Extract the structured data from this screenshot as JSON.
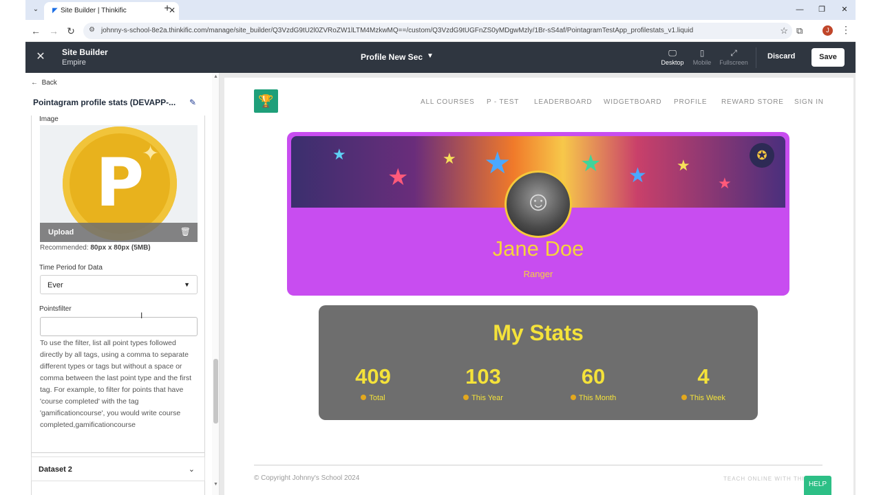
{
  "browser": {
    "tab_title": "Site Builder | Thinkific",
    "tab_favicon": "thinkific-icon",
    "url": "johnny-s-school-8e2a.thinkific.com/manage/site_builder/Q3VzdG9tU2l0ZVRoZW1lLTM4MzkwMQ==/custom/Q3VzdG9tUGFnZS0yMDgwMzly/1Br-sS4af/PointagramTestApp_profilestats_v1.liquid",
    "avatar_initial": "J",
    "avatar_color": "#c0462a"
  },
  "site_builder": {
    "title": "Site Builder",
    "theme": "Empire",
    "page_name": "Profile New Sec",
    "views": [
      "Desktop",
      "Mobile",
      "Fullscreen"
    ],
    "active_view": "Desktop",
    "discard_label": "Discard",
    "save_label": "Save"
  },
  "panel": {
    "back_label": "Back",
    "title": "Pointagram profile stats (DEVAPP-...",
    "image_label": "Image",
    "upload_label": "Upload",
    "recommended_prefix": "Recommended: ",
    "recommended_value": "80px x 80px (5MB)",
    "time_period_label": "Time Period for Data",
    "time_period_value": "Ever",
    "pointsfilter_label": "Pointsfilter",
    "pointsfilter_value": "",
    "pointsfilter_help": "To use the filter, list all point types followed directly by all tags, using a comma to separate different types or tags but without a space or comma between the last point type and the first tag. For example, to filter for points that have 'course completed' with the tag 'gamificationcourse', you would write course completed,gamificationcourse",
    "dataset2_label": "Dataset 2",
    "coin_letter": "P"
  },
  "preview": {
    "nav_items": [
      "ALL COURSES",
      "P - TEST",
      "LEADERBOARD",
      "WIDGETBOARD",
      "PROFILE",
      "REWARD STORE",
      "SIGN IN"
    ],
    "profile_name": "Jane Doe",
    "profile_rank": "Ranger",
    "stats_title": "My Stats",
    "stats": [
      {
        "value": "409",
        "label": "Total"
      },
      {
        "value": "103",
        "label": "This Year"
      },
      {
        "value": "60",
        "label": "This Month"
      },
      {
        "value": "4",
        "label": "This Week"
      }
    ],
    "copyright": "© Copyright Johnny's School 2024",
    "teach_online": "TEACH ONLINE WITH THIN",
    "help_label": "HELP",
    "colors": {
      "card_purple": "#c84df0",
      "stats_gray": "#6e6e6e",
      "accent_yellow": "#f4e23a",
      "logo_green": "#1f9f7a",
      "help_green": "#2dbf86"
    }
  }
}
